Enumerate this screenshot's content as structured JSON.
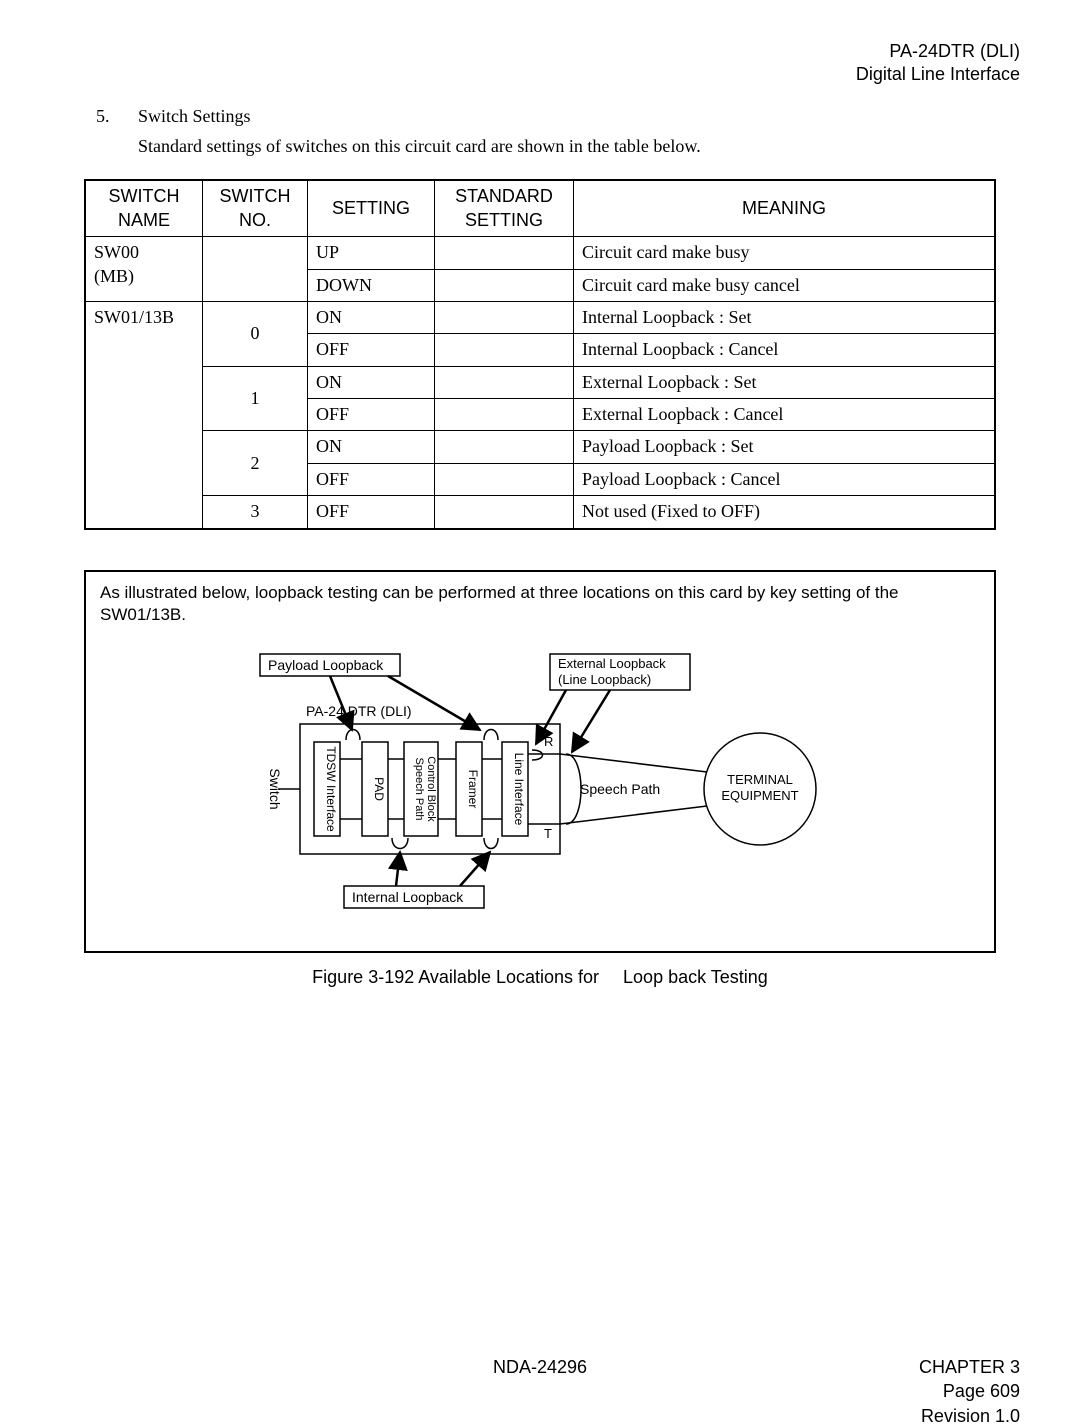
{
  "header": {
    "line1": "PA-24DTR (DLI)",
    "line2": "Digital Line Interface"
  },
  "section": {
    "num": "5.",
    "title": "Switch Settings",
    "intro": "Standard settings of switches on this circuit card are shown in the table below."
  },
  "table": {
    "headers": {
      "switch_name": "SWITCH NAME",
      "switch_no": "SWITCH NO.",
      "setting": "SETTING",
      "standard_setting": "STANDARD SETTING",
      "meaning": "MEANING"
    },
    "rows": [
      {
        "name": "SW00\n(MB)",
        "no": "",
        "setting": "UP",
        "standard": "",
        "meaning": "Circuit card make busy"
      },
      {
        "name": "",
        "no": "",
        "setting": "DOWN",
        "standard": "",
        "meaning": "Circuit card make busy cancel"
      },
      {
        "name": "SW01/13B",
        "no": "0",
        "setting": "ON",
        "standard": "",
        "meaning": "Internal Loopback : Set"
      },
      {
        "name": "",
        "no": "",
        "setting": "OFF",
        "standard": "",
        "meaning": "Internal Loopback : Cancel"
      },
      {
        "name": "",
        "no": "1",
        "setting": "ON",
        "standard": "",
        "meaning": "External Loopback : Set"
      },
      {
        "name": "",
        "no": "",
        "setting": "OFF",
        "standard": "",
        "meaning": "External Loopback : Cancel"
      },
      {
        "name": "",
        "no": "2",
        "setting": "ON",
        "standard": "",
        "meaning": "Payload Loopback : Set"
      },
      {
        "name": "",
        "no": "",
        "setting": "OFF",
        "standard": "",
        "meaning": "Payload Loopback : Cancel"
      },
      {
        "name": "",
        "no": "3",
        "setting": "OFF",
        "standard": "",
        "meaning": "Not used (Fixed to OFF)"
      }
    ]
  },
  "figure": {
    "intro": "As illustrated below, loopback testing can be performed at three locations on this card by key setting of the SW01/13B.",
    "labels": {
      "payload_loopback_box": "Payload Loopback",
      "external_loopback_box_l1": "External Loopback",
      "external_loopback_box_l2": "(Line Loopback)",
      "card_title": "PA-24 DTR (DLI)",
      "switch": "Switch",
      "tdsw": "TDSW Interface",
      "pad": "PAD",
      "spcb_l1": "Speech Path",
      "spcb_l2": "Control Block",
      "framer": "Framer",
      "line_if": "Line Interface",
      "r": "R",
      "t": "T",
      "speech_path": "Speech Path",
      "terminal_l1": "TERMINAL",
      "terminal_l2": "EQUIPMENT",
      "internal_loopback_box": "Internal Loopback"
    },
    "caption_left": "Figure 3-192   Available Locations for",
    "caption_right": "Loop back Testing"
  },
  "footer": {
    "doc_no": "NDA-24296",
    "chapter": "CHAPTER 3",
    "page": "Page 609",
    "rev": "Revision 1.0"
  }
}
